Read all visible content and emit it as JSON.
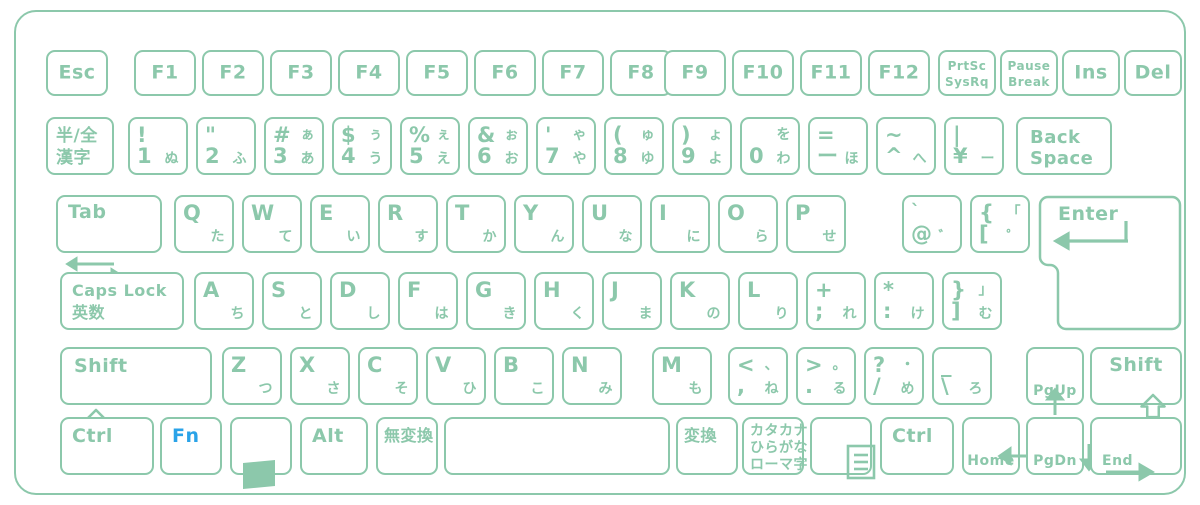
{
  "meta": {
    "device": "japanese-jis-laptop-keyboard",
    "accent": "#8cc8ab",
    "fn_color": "#2aa3e8",
    "background": "#ffffff"
  },
  "rows": {
    "function": [
      {
        "name": "esc",
        "label": "Esc"
      },
      {
        "name": "f1",
        "label": "F1"
      },
      {
        "name": "f2",
        "label": "F2"
      },
      {
        "name": "f3",
        "label": "F3"
      },
      {
        "name": "f4",
        "label": "F4"
      },
      {
        "name": "f5",
        "label": "F5"
      },
      {
        "name": "f6",
        "label": "F6"
      },
      {
        "name": "f7",
        "label": "F7"
      },
      {
        "name": "f8",
        "label": "F8"
      },
      {
        "name": "f9",
        "label": "F9"
      },
      {
        "name": "f10",
        "label": "F10"
      },
      {
        "name": "f11",
        "label": "F11"
      },
      {
        "name": "f12",
        "label": "F12"
      },
      {
        "name": "prtsc",
        "line1": "PrtSc",
        "line2": "SysRq"
      },
      {
        "name": "pause",
        "line1": "Pause",
        "line2": "Break"
      },
      {
        "name": "ins",
        "label": "Ins"
      },
      {
        "name": "del",
        "label": "Del"
      }
    ],
    "number": [
      {
        "name": "hankaku-zenkaku",
        "line1": "半/全",
        "line2": "漢字"
      },
      {
        "name": "digit-1",
        "tl": "!",
        "bl": "1",
        "br": "ぬ"
      },
      {
        "name": "digit-2",
        "tl": "\"",
        "bl": "2",
        "br": "ふ"
      },
      {
        "name": "digit-3",
        "tl": "#",
        "bl": "3",
        "tr": "ぁ",
        "br": "あ"
      },
      {
        "name": "digit-4",
        "tl": "$",
        "bl": "4",
        "tr": "ぅ",
        "br": "う"
      },
      {
        "name": "digit-5",
        "tl": "%",
        "bl": "5",
        "tr": "ぇ",
        "br": "え"
      },
      {
        "name": "digit-6",
        "tl": "&",
        "bl": "6",
        "tr": "ぉ",
        "br": "お"
      },
      {
        "name": "digit-7",
        "tl": "'",
        "bl": "7",
        "tr": "ゃ",
        "br": "や"
      },
      {
        "name": "digit-8",
        "tl": "(",
        "bl": "8",
        "tr": "ゅ",
        "br": "ゆ"
      },
      {
        "name": "digit-9",
        "tl": ")",
        "bl": "9",
        "tr": "ょ",
        "br": "よ"
      },
      {
        "name": "digit-0",
        "tl": "",
        "bl": "0",
        "tr": "を",
        "br": "わ"
      },
      {
        "name": "minus",
        "tl": "=",
        "bl": "ー",
        "br": "ほ"
      },
      {
        "name": "caret",
        "tl": "~",
        "bl": "^",
        "br": "へ"
      },
      {
        "name": "yen",
        "tl": "|",
        "bl": "¥",
        "br": "ー"
      },
      {
        "name": "backspace",
        "line1": "Back",
        "line2": "Space"
      }
    ],
    "qwerty": [
      {
        "name": "tab",
        "label": "Tab",
        "icon": "tab-arrows-icon"
      },
      {
        "name": "key-q",
        "tl": "Q",
        "br": "た"
      },
      {
        "name": "key-w",
        "tl": "W",
        "br": "て"
      },
      {
        "name": "key-e",
        "tl": "E",
        "br": "い"
      },
      {
        "name": "key-r",
        "tl": "R",
        "br": "す"
      },
      {
        "name": "key-t",
        "tl": "T",
        "br": "か"
      },
      {
        "name": "key-y",
        "tl": "Y",
        "br": "ん"
      },
      {
        "name": "key-u",
        "tl": "U",
        "br": "な"
      },
      {
        "name": "key-i",
        "tl": "I",
        "br": "に"
      },
      {
        "name": "key-o",
        "tl": "O",
        "br": "ら"
      },
      {
        "name": "key-p",
        "tl": "P",
        "br": "せ"
      },
      {
        "name": "at",
        "tl": "`",
        "bl": "@",
        "br": "゛"
      },
      {
        "name": "bracket-left",
        "tl": "{",
        "bl": "[",
        "tr": "「",
        "br": "゜"
      },
      {
        "name": "enter",
        "label": "Enter",
        "icon": "enter-arrow-icon"
      }
    ],
    "home": [
      {
        "name": "capslock",
        "line1": "Caps Lock",
        "line2": "英数"
      },
      {
        "name": "key-a",
        "tl": "A",
        "br": "ち"
      },
      {
        "name": "key-s",
        "tl": "S",
        "br": "と"
      },
      {
        "name": "key-d",
        "tl": "D",
        "br": "し"
      },
      {
        "name": "key-f",
        "tl": "F",
        "br": "は"
      },
      {
        "name": "key-g",
        "tl": "G",
        "br": "き"
      },
      {
        "name": "key-h",
        "tl": "H",
        "br": "く"
      },
      {
        "name": "key-j",
        "tl": "J",
        "br": "ま"
      },
      {
        "name": "key-k",
        "tl": "K",
        "br": "の"
      },
      {
        "name": "key-l",
        "tl": "L",
        "br": "り"
      },
      {
        "name": "semicolon",
        "tl": "+",
        "bl": ";",
        "br": "れ"
      },
      {
        "name": "colon",
        "tl": "*",
        "bl": ":",
        "br": "け"
      },
      {
        "name": "bracket-right",
        "tl": "}",
        "bl": "]",
        "tr": "」",
        "br": "む"
      }
    ],
    "shift": [
      {
        "name": "shift-left",
        "label": "Shift",
        "icon": "shift-arrow-icon"
      },
      {
        "name": "key-z",
        "tl": "Z",
        "br": "つ"
      },
      {
        "name": "key-x",
        "tl": "X",
        "br": "さ"
      },
      {
        "name": "key-c",
        "tl": "C",
        "br": "そ"
      },
      {
        "name": "key-v",
        "tl": "V",
        "br": "ひ"
      },
      {
        "name": "key-b",
        "tl": "B",
        "br": "こ"
      },
      {
        "name": "key-n",
        "tl": "N",
        "br": "み"
      },
      {
        "name": "key-m",
        "tl": "M",
        "br": "も"
      },
      {
        "name": "comma",
        "tl": "<",
        "bl": ",",
        "tr": "、",
        "br": "ね"
      },
      {
        "name": "period",
        "tl": ">",
        "bl": ".",
        "tr": "。",
        "br": "る"
      },
      {
        "name": "slash",
        "tl": "?",
        "bl": "/",
        "tr": "・",
        "br": "め"
      },
      {
        "name": "backslash-ro",
        "tl": "_",
        "bl": "\\",
        "br": "ろ"
      },
      {
        "name": "arrow-up",
        "icon": "arrow-up-icon",
        "sub": "PgUp"
      },
      {
        "name": "shift-right",
        "label": "Shift",
        "icon": "shift-arrow-icon"
      }
    ],
    "bottom": [
      {
        "name": "ctrl-left",
        "label": "Ctrl"
      },
      {
        "name": "fn",
        "label": "Fn",
        "accent": "fn"
      },
      {
        "name": "windows",
        "icon": "windows-icon"
      },
      {
        "name": "alt-left",
        "label": "Alt"
      },
      {
        "name": "muhenkan",
        "label": "無変換"
      },
      {
        "name": "space",
        "label": ""
      },
      {
        "name": "henkan",
        "label": "変換"
      },
      {
        "name": "katakana-hiragana",
        "line1": "カタカナ",
        "line2": "ひらがな",
        "line3": "ローマ字"
      },
      {
        "name": "menu",
        "icon": "menu-icon"
      },
      {
        "name": "ctrl-right",
        "label": "Ctrl"
      },
      {
        "name": "arrow-left",
        "icon": "arrow-left-icon",
        "sub": "Home"
      },
      {
        "name": "arrow-down",
        "icon": "arrow-down-icon",
        "sub": "PgDn"
      },
      {
        "name": "arrow-right",
        "icon": "arrow-right-icon",
        "sub": "End"
      }
    ]
  }
}
